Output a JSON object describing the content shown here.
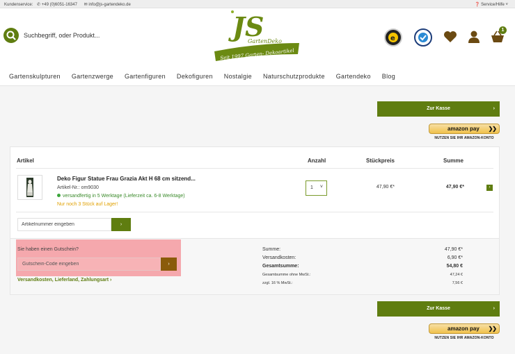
{
  "topbar": {
    "service_text": "Kundenservice:",
    "phone": "+49 (0)6051-16347",
    "email": "info@js-gartendeko.de",
    "help": "Service/Hilfe"
  },
  "header": {
    "search_placeholder": "Suchbegriff, oder Produkt...",
    "logo_main": "JS",
    "logo_sub": "GartenDeko",
    "logo_banner": "Seit 1997 Garten- Dekoartikel",
    "cart_count": "1"
  },
  "nav": [
    "Gartenskulpturen",
    "Gartenzwerge",
    "Gartenfiguren",
    "Dekofiguren",
    "Nostalgie",
    "Naturschutzprodukte",
    "Gartendeko",
    "Blog"
  ],
  "checkout": {
    "button_label": "Zur Kasse",
    "amazon_label": "amazon pay",
    "amazon_caption": "NUTZEN SIE IHR AMAZON-KONTO"
  },
  "cart": {
    "headers": {
      "article": "Artikel",
      "qty": "Anzahl",
      "unit": "Stückpreis",
      "total": "Summe"
    },
    "item": {
      "name": "Deko Figur Statue Frau Grazia Akt H 68 cm sitzend...",
      "artnr": "Artikel-Nr.: om9030",
      "shipping": "versandfertig in 5 Werktage (Lieferzeit ca. 6-8 Werktage)",
      "stock": "Nur noch 3 Stück auf Lager!",
      "qty": "1",
      "unit_price": "47,90 €*",
      "total": "47,90 €*"
    },
    "artnr_placeholder": "Artikelnummer eingeben"
  },
  "coupon": {
    "question": "Sie haben einen Gutschein?",
    "placeholder": "Gutschein-Code eingeben",
    "shipping_link": "Versandkosten, Lieferland, Zahlungsart ›"
  },
  "summary": [
    {
      "label": "Summe:",
      "value": "47,90 €*"
    },
    {
      "label": "Versandkosten:",
      "value": "6,90 €*"
    },
    {
      "label": "Gesamtsumme:",
      "value": "54,80 €"
    },
    {
      "label": "Gesamtsumme ohne MwSt.:",
      "value": "47,24 €"
    },
    {
      "label": "zzgl. 16 % MwSt.:",
      "value": "7,56 €"
    }
  ],
  "colors": {
    "brand": "#5f7d10",
    "highlight": "#f5a8ad",
    "amazon": "#f0c14b"
  }
}
